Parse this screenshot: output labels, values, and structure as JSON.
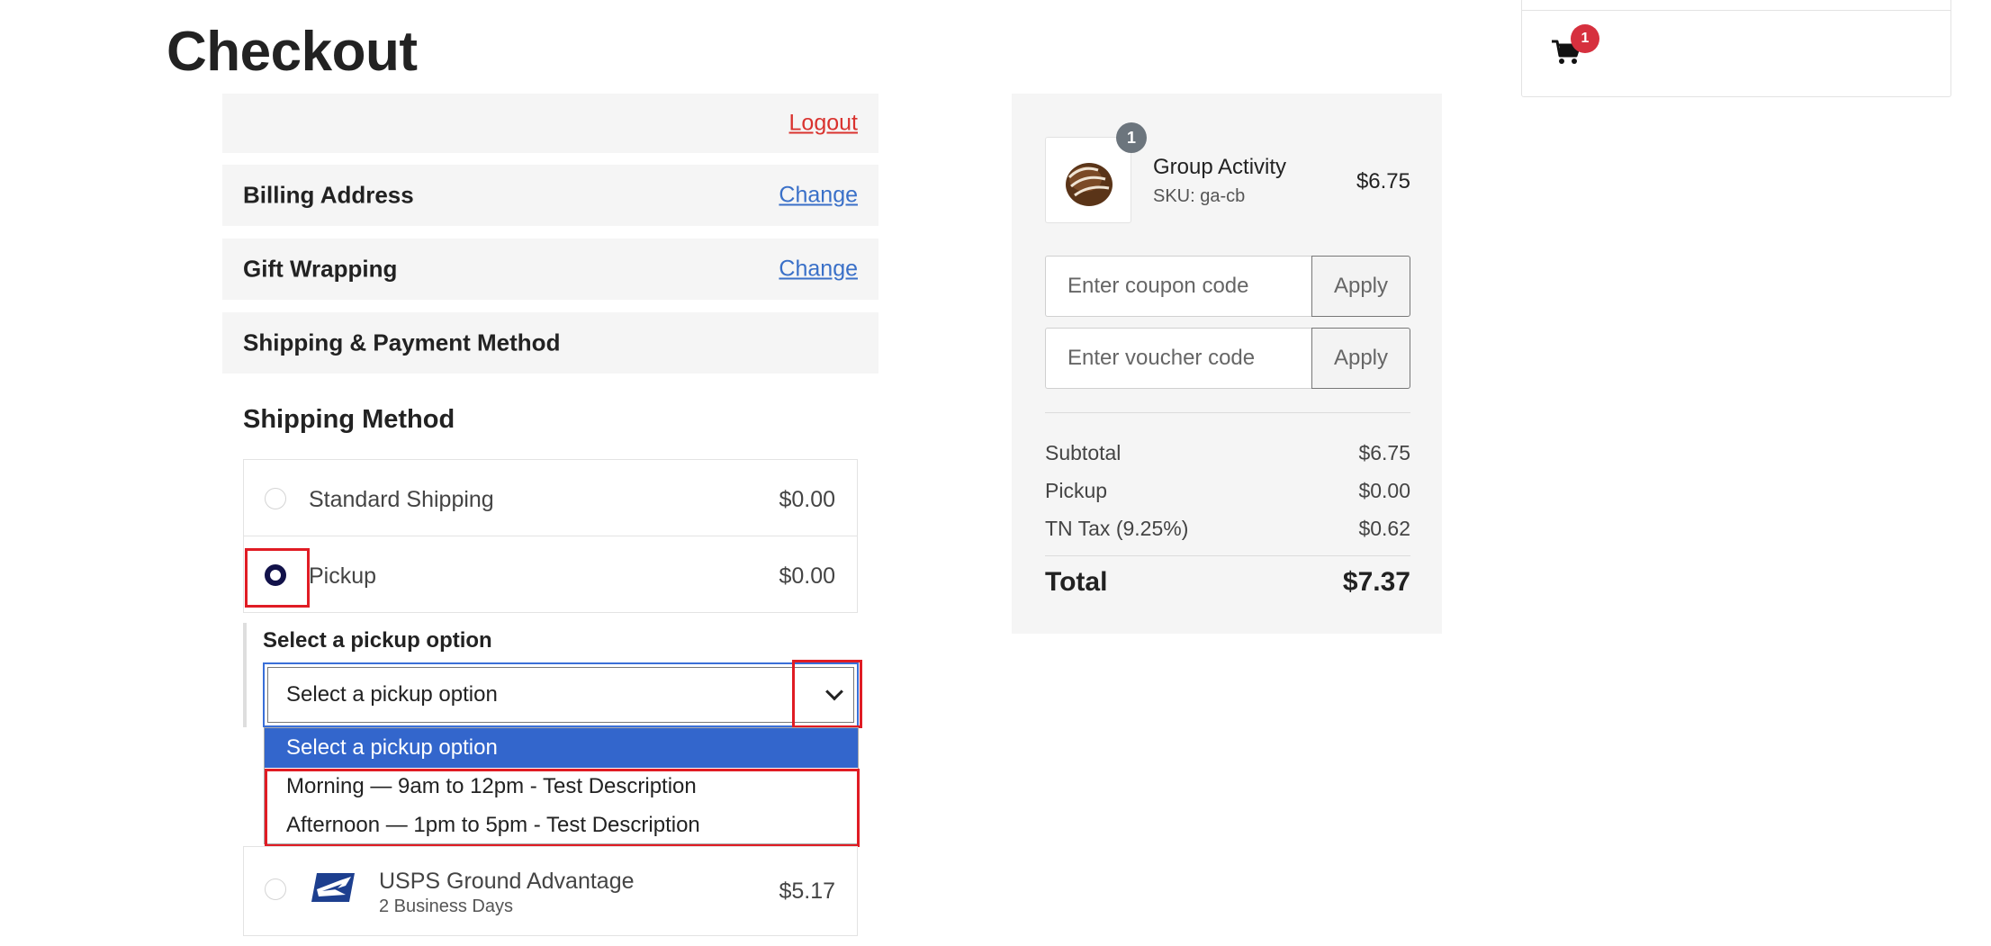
{
  "page": {
    "title": "Checkout"
  },
  "sections": {
    "logout_label": "Logout",
    "billing": {
      "title": "Billing Address",
      "link": "Change"
    },
    "gift": {
      "title": "Gift Wrapping",
      "link": "Change"
    },
    "shipping_payment": {
      "title": "Shipping & Payment Method"
    }
  },
  "shipping": {
    "title": "Shipping Method",
    "options": [
      {
        "label": "Standard Shipping",
        "price": "$0.00",
        "selected": false
      },
      {
        "label": "Pickup",
        "price": "$0.00",
        "selected": true
      },
      {
        "label": "USPS Ground Advantage",
        "sub": "2 Business Days",
        "price": "$5.17",
        "selected": false,
        "icon": "usps-eagle-icon"
      }
    ],
    "pickup": {
      "label": "Select a pickup option",
      "value": "Select a pickup option",
      "dropdown_options": [
        "Select a pickup option",
        "Morning — 9am to 12pm - Test Description",
        "Afternoon — 1pm to 5pm - Test Description"
      ]
    }
  },
  "summary": {
    "item": {
      "qty": "1",
      "name": "Group Activity",
      "sku": "SKU: ga-cb",
      "price": "$6.75"
    },
    "coupon": {
      "placeholder": "Enter coupon code",
      "apply": "Apply"
    },
    "voucher": {
      "placeholder": "Enter voucher code",
      "apply": "Apply"
    },
    "subtotal": {
      "label": "Subtotal",
      "value": "$6.75"
    },
    "pickup": {
      "label": "Pickup",
      "value": "$0.00"
    },
    "tax": {
      "label": "TN Tax (9.25%)",
      "value": "$0.62"
    },
    "total": {
      "label": "Total",
      "value": "$7.37"
    }
  },
  "mini_cart": {
    "count": "1"
  },
  "colors": {
    "accent_blue": "#3366cc",
    "link_red": "#d9322e",
    "link_blue": "#3a70c8",
    "radio_checked": "#12124a",
    "highlight_red": "#e01c24",
    "badge_red": "#d6303e"
  }
}
